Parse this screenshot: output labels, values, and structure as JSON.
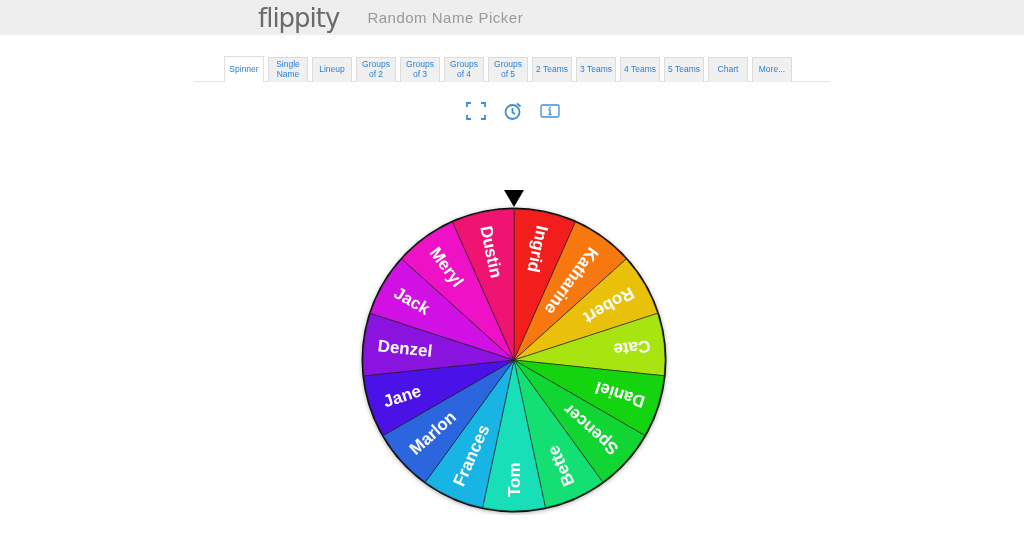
{
  "header": {
    "logo": "flippity",
    "title": "Random Name Picker"
  },
  "tabs": [
    {
      "label": "Spinner",
      "selected": true
    },
    {
      "label": "Single Name",
      "selected": false
    },
    {
      "label": "Lineup",
      "selected": false
    },
    {
      "label": "Groups of 2",
      "selected": false
    },
    {
      "label": "Groups of 3",
      "selected": false
    },
    {
      "label": "Groups of 4",
      "selected": false
    },
    {
      "label": "Groups of 5",
      "selected": false
    },
    {
      "label": "2 Teams",
      "selected": false
    },
    {
      "label": "3 Teams",
      "selected": false
    },
    {
      "label": "4 Teams",
      "selected": false
    },
    {
      "label": "5 Teams",
      "selected": false
    },
    {
      "label": "Chart",
      "selected": false
    },
    {
      "label": "More...",
      "selected": false
    }
  ],
  "tools": [
    {
      "kind": "fullscreen"
    },
    {
      "kind": "timer"
    },
    {
      "kind": "info"
    }
  ],
  "wheel": {
    "segments": [
      {
        "label": "Ingrid",
        "color": "#f21d1d"
      },
      {
        "label": "Katharine",
        "color": "#f6780e"
      },
      {
        "label": "Robert",
        "color": "#e9c10b"
      },
      {
        "label": "Cate",
        "color": "#a8e510"
      },
      {
        "label": "Daniel",
        "color": "#14d410"
      },
      {
        "label": "Spencer",
        "color": "#10d532"
      },
      {
        "label": "Bette",
        "color": "#13df72"
      },
      {
        "label": "Tom",
        "color": "#18dfb8"
      },
      {
        "label": "Frances",
        "color": "#17b4e4"
      },
      {
        "label": "Marlon",
        "color": "#2b66df"
      },
      {
        "label": "Jane",
        "color": "#4a12e6"
      },
      {
        "label": "Denzel",
        "color": "#8b13df"
      },
      {
        "label": "Jack",
        "color": "#d110e4"
      },
      {
        "label": "Meryl",
        "color": "#ee11c5"
      },
      {
        "label": "Dustin",
        "color": "#f01472"
      }
    ]
  }
}
